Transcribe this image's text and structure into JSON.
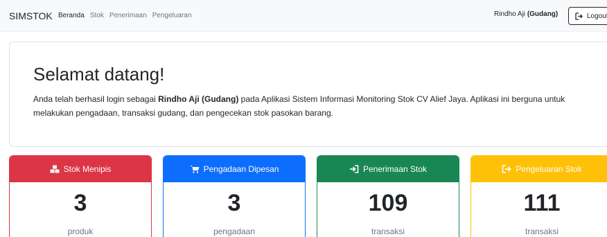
{
  "navbar": {
    "brand": "SIMSTOK",
    "links": [
      {
        "label": "Beranda"
      },
      {
        "label": "Stok"
      },
      {
        "label": "Penerimaan"
      },
      {
        "label": "Pengeluaran"
      }
    ],
    "user_name": "Rindho Aji",
    "user_role": "(Gudang)",
    "logout_label": "Logout"
  },
  "welcome": {
    "title": "Selamat datang!",
    "text_before": "Anda telah berhasil login sebagai ",
    "text_user": "Rindho Aji (Gudang)",
    "text_after": " pada Aplikasi Sistem Informasi Monitoring Stok CV Alief Jaya. Aplikasi ini berguna untuk melakukan pengadaan, transaksi gudang, dan pengecekan stok pasokan barang."
  },
  "cards": [
    {
      "title": "Stok Menipis",
      "value": "3",
      "unit": "produk",
      "color": "#dc3545",
      "icon": "cubes-icon"
    },
    {
      "title": "Pengadaan Dipesan",
      "value": "3",
      "unit": "pengadaan",
      "color": "#0d6efd",
      "icon": "cart-icon"
    },
    {
      "title": "Penerimaan Stok",
      "value": "109",
      "unit": "transaksi",
      "color": "#198754",
      "icon": "sign-in-icon"
    },
    {
      "title": "Pengeluaran Stok",
      "value": "111",
      "unit": "transaksi",
      "color": "#ffc107",
      "icon": "sign-out-icon"
    }
  ]
}
